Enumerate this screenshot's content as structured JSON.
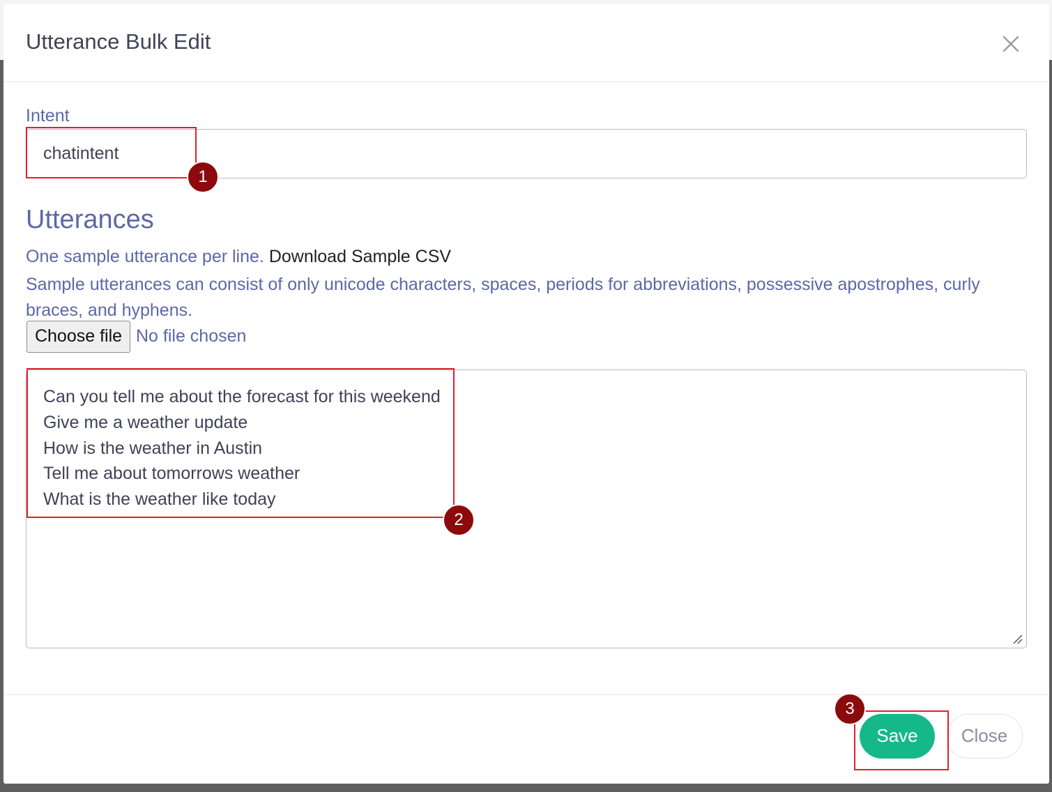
{
  "dialog": {
    "title": "Utterance Bulk Edit"
  },
  "intent": {
    "label": "Intent",
    "value": "chatintent"
  },
  "utterances": {
    "heading": "Utterances",
    "hint_prefix": "One sample utterance per line.",
    "download_link": "Download Sample CSV",
    "rules_text": "Sample utterances can consist of only unicode characters, spaces, periods for abbreviations, possessive apostrophes, curly braces, and hyphens.",
    "file_button": "Choose file",
    "file_status": "No file chosen",
    "lines": [
      "Can you tell me about the forecast for this weekend",
      "Give me a weather update",
      "How is the weather in Austin",
      "Tell me about tomorrows weather",
      "What is the weather like today"
    ]
  },
  "footer": {
    "save_label": "Save",
    "close_label": "Close"
  },
  "callouts": [
    {
      "number": "1"
    },
    {
      "number": "2"
    },
    {
      "number": "3"
    }
  ],
  "colors": {
    "accent_text": "#5c68a6",
    "save_green": "#15b989",
    "callout_red": "#e0202a",
    "badge_dark_red": "#8c0a0c"
  }
}
